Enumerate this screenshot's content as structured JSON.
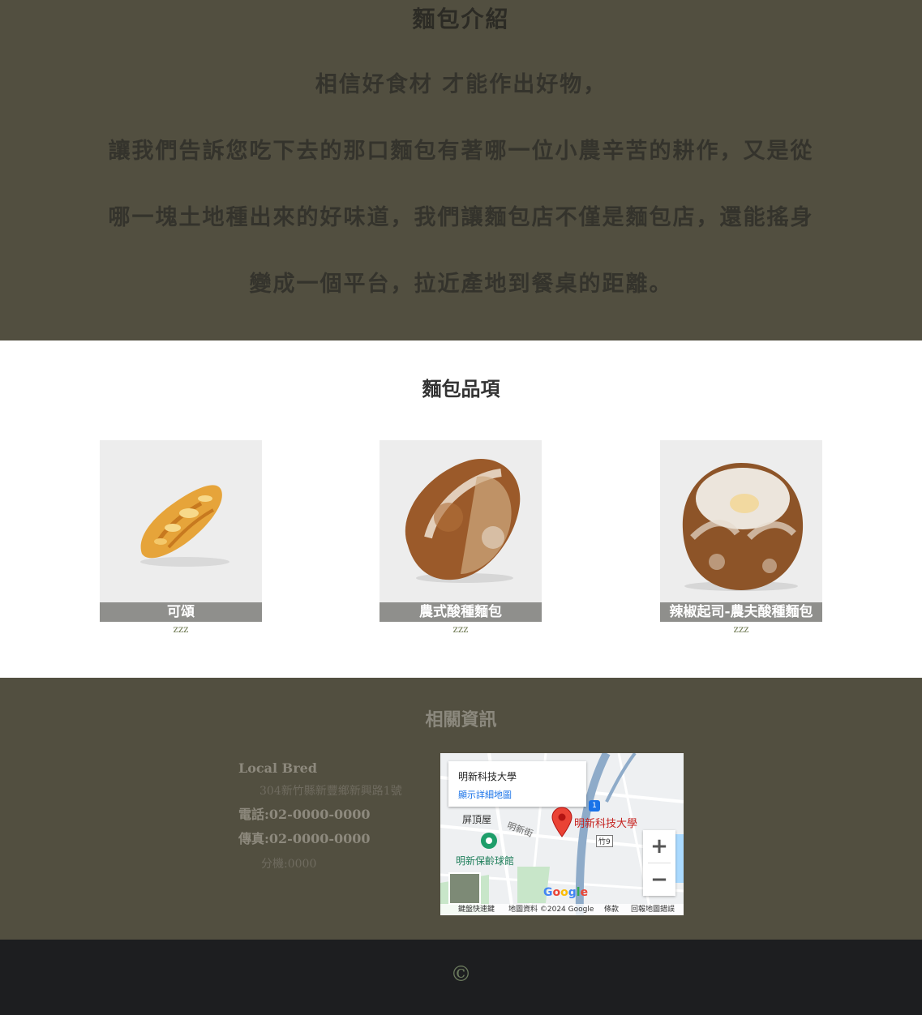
{
  "intro": {
    "title": "麵包介紹",
    "lines": [
      "相信好食材 才能作出好物，",
      "讓我們告訴您吃下去的那口麵包有著哪一位小農辛苦的耕作，又是從",
      "哪一塊土地種出來的好味道，我們讓麵包店不僅是麵包店，還能搖身",
      "變成一個平台，拉近產地到餐桌的距離。"
    ]
  },
  "products": {
    "title": "麵包品項",
    "items": [
      {
        "name": "可頌",
        "desc": "zzz",
        "icon": "croissant-image"
      },
      {
        "name": "農式酸種麵包",
        "desc": "zzz",
        "icon": "sourdough-loaf-image"
      },
      {
        "name": "辣椒起司-農夫酸種麵包",
        "desc": "zzz",
        "icon": "round-sourdough-image"
      }
    ]
  },
  "info": {
    "title": "相關資訊",
    "brand": "Local Bred",
    "address": "304新竹縣新豐鄉新興路1號",
    "phone": "電話:02-0000-0000",
    "fax": "傳真:02-0000-0000",
    "extension": "分機:0000"
  },
  "map": {
    "place_name": "明新科技大學",
    "detail_link": "顯示詳細地圖",
    "marker_label": "明新科技大學",
    "poi_1": "屏頂屋",
    "poi_2": "明新保齡球館",
    "street_1": "明新街",
    "road_badge": "1",
    "road_code": "竹9",
    "zoom_in": "+",
    "zoom_out": "−",
    "logo": "Google",
    "footer_shortcuts": "鍵盤快速鍵",
    "footer_data": "地圖資料 ©2024 Google",
    "footer_terms": "條款",
    "footer_report": "回報地圖錯誤",
    "colors": {
      "marker": "#ea4335",
      "road": "#8eabc9",
      "park": "#c8e6c9",
      "water": "#aadaff"
    }
  },
  "footer": {
    "copyright": "©"
  }
}
